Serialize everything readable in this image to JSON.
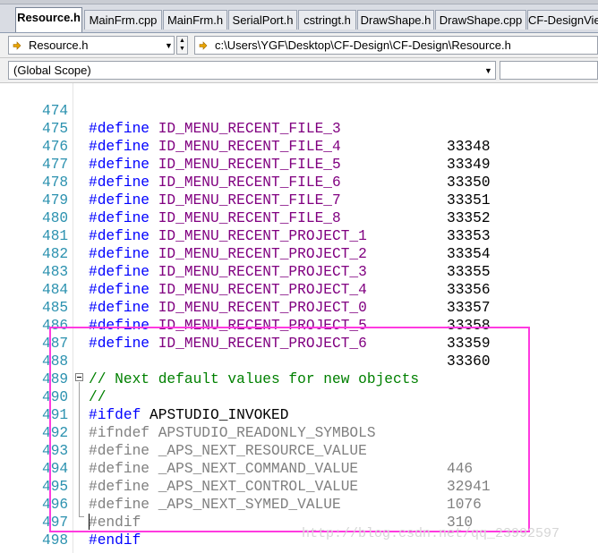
{
  "tabs": [
    {
      "label": "Resource.h",
      "active": true
    },
    {
      "label": "MainFrm.cpp"
    },
    {
      "label": "MainFrm.h"
    },
    {
      "label": "SerialPort.h"
    },
    {
      "label": "cstringt.h"
    },
    {
      "label": "DrawShape.h"
    },
    {
      "label": "DrawShape.cpp"
    },
    {
      "label": "CF-DesignView"
    }
  ],
  "navbar": {
    "file_name": "Resource.h",
    "file_path": "c:\\Users\\YGF\\Desktop\\CF-Design\\CF-Design\\Resource.h",
    "scope": "(Global Scope)"
  },
  "editor": {
    "lines": [
      {
        "n": "474",
        "code": "#define ID_MENU_RECENT_FILE_3",
        "value": "33348"
      },
      {
        "n": "475",
        "code": "#define ID_MENU_RECENT_FILE_4",
        "value": "33349"
      },
      {
        "n": "476",
        "code": "#define ID_MENU_RECENT_FILE_5",
        "value": "33350"
      },
      {
        "n": "477",
        "code": "#define ID_MENU_RECENT_FILE_6",
        "value": "33351"
      },
      {
        "n": "478",
        "code": "#define ID_MENU_RECENT_FILE_7",
        "value": "33352"
      },
      {
        "n": "479",
        "code": "#define ID_MENU_RECENT_FILE_8",
        "value": "33353"
      },
      {
        "n": "480",
        "code": "#define ID_MENU_RECENT_PROJECT_1",
        "value": "33354"
      },
      {
        "n": "481",
        "code": "#define ID_MENU_RECENT_PROJECT_2",
        "value": "33355"
      },
      {
        "n": "482",
        "code": "#define ID_MENU_RECENT_PROJECT_3",
        "value": "33356"
      },
      {
        "n": "483",
        "code": "#define ID_MENU_RECENT_PROJECT_4",
        "value": "33357"
      },
      {
        "n": "484",
        "code": "#define ID_MENU_RECENT_PROJECT_0",
        "value": "33358"
      },
      {
        "n": "485",
        "code": "#define ID_MENU_RECENT_PROJECT_5",
        "value": "33359"
      },
      {
        "n": "486",
        "code": "#define ID_MENU_RECENT_PROJECT_6",
        "value": "33360"
      },
      {
        "n": "487",
        "code": "",
        "value": ""
      },
      {
        "n": "488",
        "code": "// Next default values for new objects",
        "value": ""
      },
      {
        "n": "489",
        "code": "//",
        "value": ""
      },
      {
        "n": "490",
        "code": "#ifdef APSTUDIO_INVOKED",
        "value": ""
      },
      {
        "n": "491",
        "code": "#ifndef APSTUDIO_READONLY_SYMBOLS",
        "value": ""
      },
      {
        "n": "492",
        "code": "#define _APS_NEXT_RESOURCE_VALUE",
        "value": "446"
      },
      {
        "n": "493",
        "code": "#define _APS_NEXT_COMMAND_VALUE",
        "value": "32941"
      },
      {
        "n": "494",
        "code": "#define _APS_NEXT_CONTROL_VALUE",
        "value": "1076"
      },
      {
        "n": "495",
        "code": "#define _APS_NEXT_SYMED_VALUE",
        "value": "310"
      },
      {
        "n": "496",
        "code": "#endif",
        "value": ""
      },
      {
        "n": "497",
        "code": "#endif",
        "value": ""
      },
      {
        "n": "498",
        "code": "",
        "value": ""
      }
    ]
  },
  "watermark": "http://blog.csdn.net/qq_23992597",
  "colors": {
    "keyword": "#0000ff",
    "macro": "#800080",
    "comment": "#008000",
    "inactive": "#808080",
    "line_number": "#2b91af",
    "highlight_box": "#ff3ae0"
  }
}
